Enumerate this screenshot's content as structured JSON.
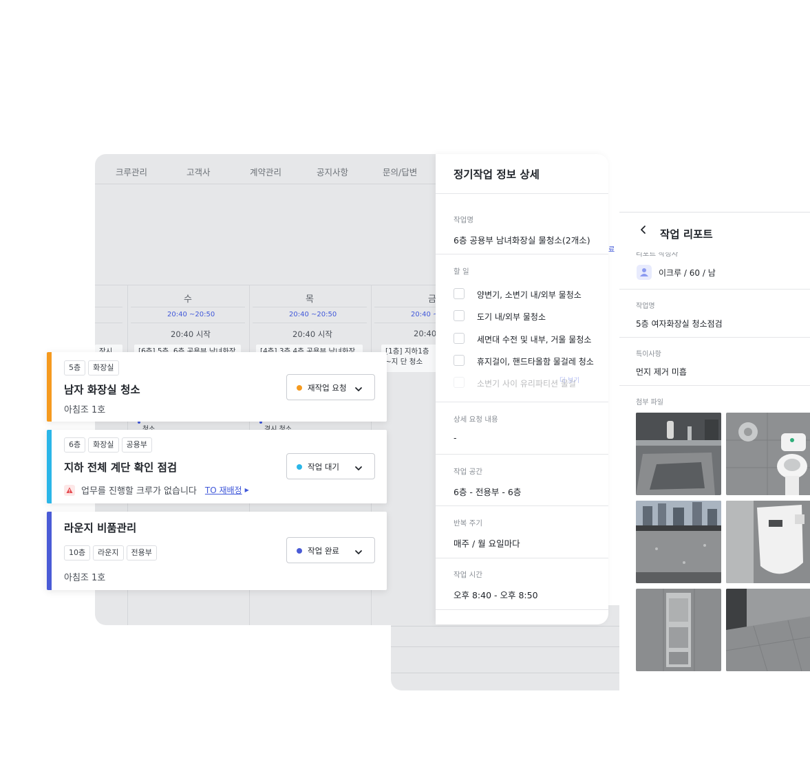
{
  "nav": [
    "크루관리",
    "고객사",
    "계약관리",
    "공지사항",
    "문의/답변"
  ],
  "calendar": {
    "days": [
      {
        "name": "수",
        "range": "20:40 ~20:50",
        "start": "20:40 시작",
        "event": "[6층] 5층, 6층 공용부 남녀화장"
      },
      {
        "name": "목",
        "range": "20:40 ~20:50",
        "start": "20:40 시작",
        "event": "[4층] 3층 4층 공용부 남녀화장"
      },
      {
        "name": "금",
        "range": "20:40 ~",
        "start": "20:40",
        "event": "[1층] 지하1층~지 단 청소"
      }
    ],
    "left_cut": "장시 청",
    "snippet_wed": "청소",
    "snippet_thu": "경시 청소",
    "side_cut": "료"
  },
  "detail": {
    "title": "정기작업 정보 상세",
    "task_name_label": "작업명",
    "task_name": "6층 공용부 남녀화장실 물청소(2개소)",
    "todo_label": "할 일",
    "todos": [
      "양변기, 소변기 내/외부 물청소",
      "도기 내/외부 물청소",
      "세면대 수전 및 내부, 거울 물청소",
      "휴지걸이, 핸드타올함 물걸레 청소",
      "소변기 사이 유리파티션 물걸"
    ],
    "more": "더 보기",
    "request_label": "상세 요청 내용",
    "request": "-",
    "space_label": "작업 공간",
    "space": "6층 - 전용부 - 6층",
    "cycle_label": "반복 주기",
    "cycle": "매주 / 월 요일마다",
    "time_label": "작업 시간",
    "time": "오후 8:40 - 오후 8:50"
  },
  "report": {
    "title": "작업 리포트",
    "cut_label": "리포트 작성자",
    "user": "이크루 / 60 / 남",
    "task_label": "작업명",
    "task": "5층 여자화장실 청소점검",
    "note_label": "특이사항",
    "note": "먼지 제거 미흡",
    "file_label": "첨부 파일"
  },
  "tasks": [
    {
      "tags": [
        "5층",
        "화장실"
      ],
      "title": "남자 화장실 청소",
      "sub": "아침조 1호",
      "status": "재작업 요청",
      "status_color": "#f59a1f",
      "bar_color": "#f59a1f"
    },
    {
      "tags": [
        "6층",
        "화장실",
        "공용부"
      ],
      "title": "지하 전체 계단 확인 점검",
      "warn": "업무를 진행할 크루가 없습니다",
      "link": "TO 재배정",
      "status": "작업 대기",
      "status_color": "#2bb6e8",
      "bar_color": "#2bb6e8"
    },
    {
      "tags": [
        "10층",
        "라운지",
        "전용부"
      ],
      "title": "라운지 비품관리",
      "sub": "아침조 1호",
      "status": "작업 완료",
      "status_color": "#4a5bd6",
      "bar_color": "#4a5bd6"
    }
  ]
}
